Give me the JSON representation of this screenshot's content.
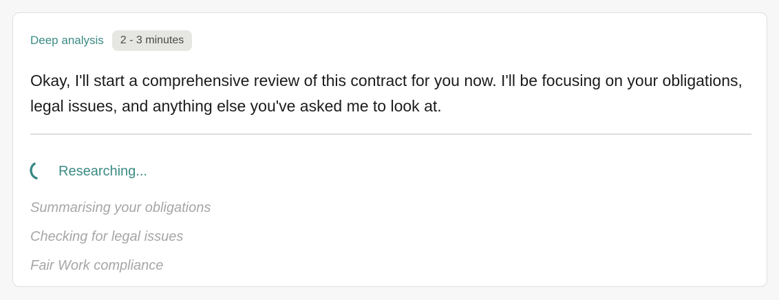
{
  "header": {
    "mode_label": "Deep analysis",
    "time_estimate": "2 - 3 minutes"
  },
  "message": {
    "text": "Okay, I'll start a comprehensive review of this contract for you now. I'll be focusing on your obligations, legal issues, and anything else you've asked me to look at."
  },
  "status": {
    "icon": "spinner-icon",
    "label": "Researching..."
  },
  "steps": [
    "Summarising your obligations",
    "Checking for legal issues",
    "Fair Work compliance"
  ],
  "colors": {
    "accent": "#3a8a84",
    "muted_step": "#a6a6a6",
    "badge_bg": "#e6e6e3"
  }
}
